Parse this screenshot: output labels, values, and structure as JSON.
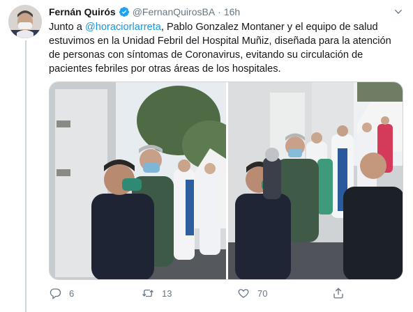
{
  "tweet": {
    "author_name": "Fernán Quirós",
    "author_handle": "@FernanQuirosBA",
    "separator": "·",
    "time": "16h",
    "text_prefix": "Junto a ",
    "mention": "@horaciorlarreta",
    "text_rest": ", Pablo Gonzalez Montaner y el equipo de salud estuvimos en la Unidad Febril del Hospital Muñiz, diseñada para la atención de personas con síntomas de Coronavirus, evitando su circulación de pacientes febriles por otras áreas de los hospitales."
  },
  "actions": {
    "reply_count": "6",
    "retweet_count": "13",
    "like_count": "70"
  },
  "colors": {
    "accent": "#1b95e0",
    "muted": "#657786",
    "text": "#14171a",
    "border": "#ccd6dd"
  },
  "icons": [
    "verified-badge-icon",
    "chevron-down-icon",
    "reply-icon",
    "retweet-icon",
    "like-icon",
    "share-icon"
  ]
}
